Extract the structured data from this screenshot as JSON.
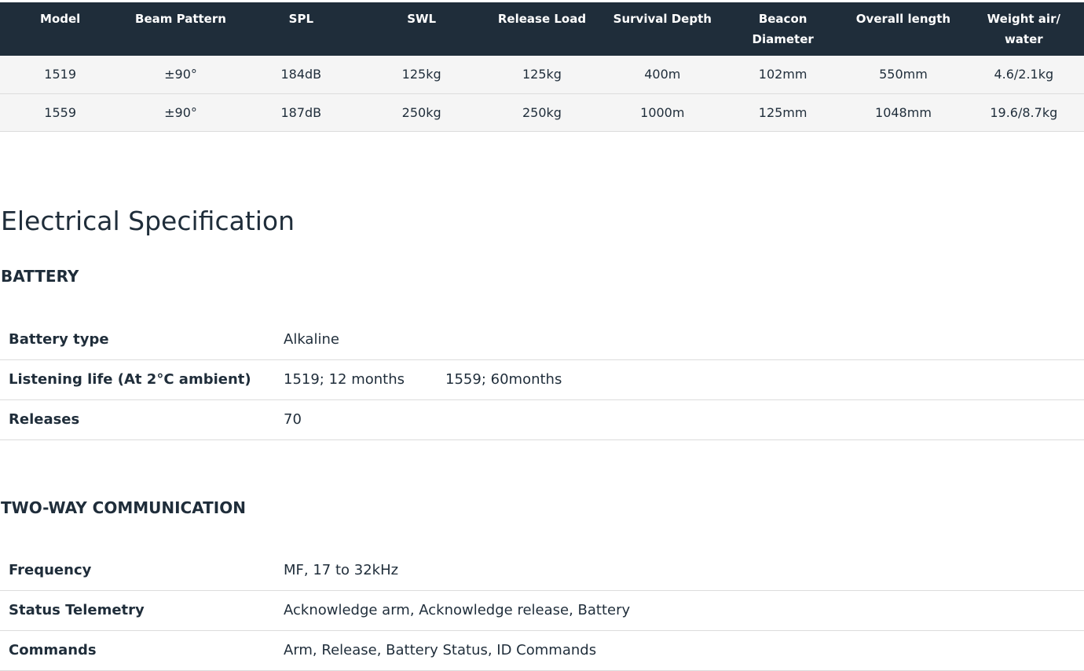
{
  "spec_table": {
    "headers": [
      "Model",
      "Beam Pattern",
      "SPL",
      "SWL",
      "Release Load",
      "Survival Depth",
      "Beacon Diameter",
      "Overall length",
      "Weight air/ water"
    ],
    "rows": [
      [
        "1519",
        "±90°",
        "184dB",
        "125kg",
        "125kg",
        "400m",
        "102mm",
        "550mm",
        "4.6/2.1kg"
      ],
      [
        "1559",
        "±90°",
        "187dB",
        "250kg",
        "250kg",
        "1000m",
        "125mm",
        "1048mm",
        "19.6/8.7kg"
      ]
    ]
  },
  "electrical": {
    "title": "Electrical Specification",
    "battery": {
      "heading": "BATTERY",
      "rows": [
        {
          "label": "Battery type",
          "value": "Alkaline"
        },
        {
          "label": "Listening life (At 2°C ambient)",
          "value": "1519; 12 months",
          "value2": "1559; 60months"
        },
        {
          "label": "Releases",
          "value": "70"
        }
      ]
    },
    "comms": {
      "heading": "TWO-WAY COMMUNICATION",
      "rows": [
        {
          "label": "Frequency",
          "value": "MF, 17 to 32kHz"
        },
        {
          "label": "Status Telemetry",
          "value": "Acknowledge arm, Acknowledge release, Battery"
        },
        {
          "label": "Commands",
          "value": "Arm, Release, Battery Status, ID Commands"
        }
      ]
    }
  },
  "colors": {
    "header_bg": "#1f2d3a",
    "text": "#1f2d3a",
    "row_bg": "#f5f5f5",
    "divider": "#dcdcdc"
  }
}
